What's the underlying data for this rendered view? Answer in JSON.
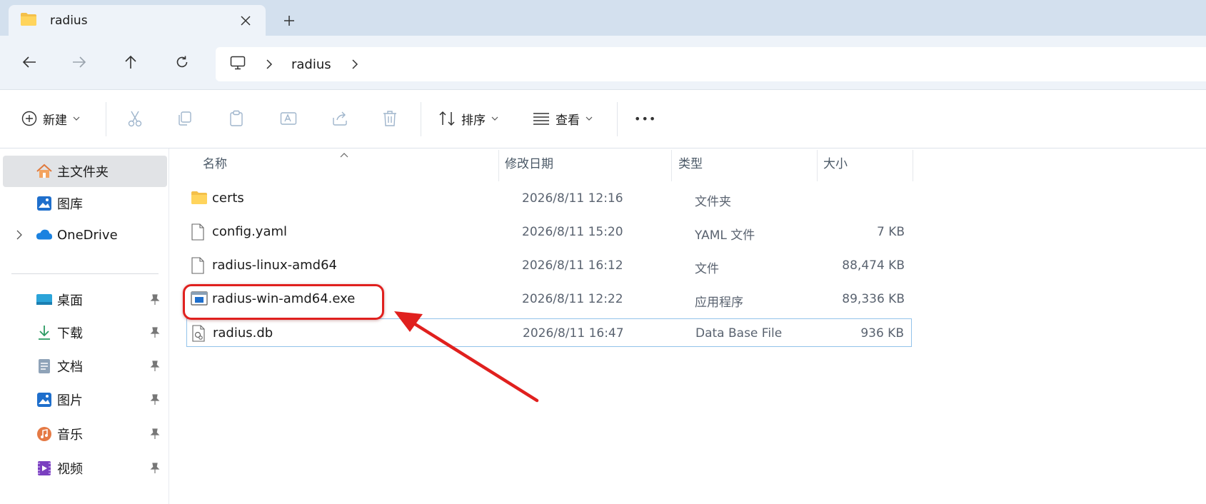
{
  "window": {
    "tab_title": "radius"
  },
  "address": {
    "crumbs": [
      "radius"
    ]
  },
  "toolbar": {
    "new_label": "新建",
    "sort_label": "排序",
    "view_label": "查看",
    "more_label": "•••"
  },
  "sidebar": {
    "items": [
      {
        "label": "主文件夹",
        "icon": "home-icon"
      },
      {
        "label": "图库",
        "icon": "gallery-icon"
      },
      {
        "label": "OneDrive",
        "icon": "onedrive-cloud-icon"
      },
      {
        "label": "桌面",
        "icon": "desktop-icon"
      },
      {
        "label": "下载",
        "icon": "download-icon"
      },
      {
        "label": "文档",
        "icon": "documents-icon"
      },
      {
        "label": "图片",
        "icon": "pictures-icon"
      },
      {
        "label": "音乐",
        "icon": "music-icon"
      },
      {
        "label": "视频",
        "icon": "videos-icon"
      }
    ]
  },
  "columns": {
    "name": "名称",
    "date": "修改日期",
    "type": "类型",
    "size": "大小"
  },
  "files": [
    {
      "name": "certs",
      "date": "2026/8/11 12:16",
      "type": "文件夹",
      "size": "",
      "icon": "folder-icon"
    },
    {
      "name": "config.yaml",
      "date": "2026/8/11 15:20",
      "type": "YAML 文件",
      "size": "7 KB",
      "icon": "file-icon"
    },
    {
      "name": "radius-linux-amd64",
      "date": "2026/8/11 16:12",
      "type": "文件",
      "size": "88,474 KB",
      "icon": "file-icon"
    },
    {
      "name": "radius-win-amd64.exe",
      "date": "2026/8/11 12:22",
      "type": "应用程序",
      "size": "89,336 KB",
      "icon": "exe-app-icon"
    },
    {
      "name": "radius.db",
      "date": "2026/8/11 16:47",
      "type": "Data Base File",
      "size": "936 KB",
      "icon": "db-file-icon"
    }
  ],
  "colors": {
    "tabstrip": "#d3e0ee",
    "navbar": "#eef3f9",
    "selection_border": "#93c3ea",
    "annotation_red": "#e0201e"
  }
}
